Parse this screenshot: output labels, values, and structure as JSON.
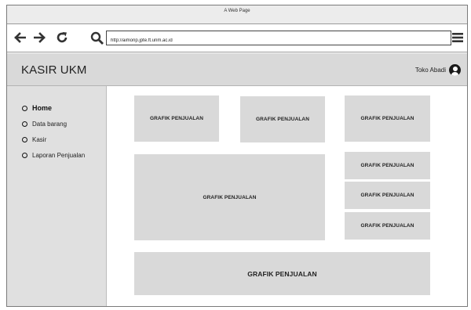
{
  "window": {
    "title": "A Web Page"
  },
  "browser": {
    "back_icon": "arrow-left-icon",
    "forward_icon": "arrow-right-icon",
    "reload_icon": "refresh-icon",
    "search_icon": "search-icon",
    "url": "http://aimonp.jpte.ft.unm.ac.id",
    "menu_icon": "hamburger-menu-icon"
  },
  "header": {
    "app_title": "KASIR UKM",
    "user_name": "Toko Abadi",
    "avatar_icon": "user-avatar-icon"
  },
  "sidebar": {
    "items": [
      {
        "label": "Home",
        "active": true
      },
      {
        "label": "Data barang",
        "active": false
      },
      {
        "label": "Kasir",
        "active": false
      },
      {
        "label": "Laporan Penjualan",
        "active": false
      }
    ]
  },
  "main": {
    "cards": [
      {
        "label": "GRAFIK PENJUALAN"
      },
      {
        "label": "GRAFIK PENJUALAN"
      },
      {
        "label": "GRAFIK PENJUALAN"
      },
      {
        "label": "GRAFIK PENJUALAN"
      },
      {
        "label": "GRAFIK PENJUALAN"
      },
      {
        "label": "GRAFIK PENJUALAN"
      },
      {
        "label": "GRAFIK PENJUALAN"
      },
      {
        "label": "GRAFIK PENJUALAN"
      }
    ]
  },
  "colors": {
    "header_bg": "#d9d9d9",
    "sidebar_bg": "#e0e0e0",
    "card_bg": "#d9d9d9"
  }
}
